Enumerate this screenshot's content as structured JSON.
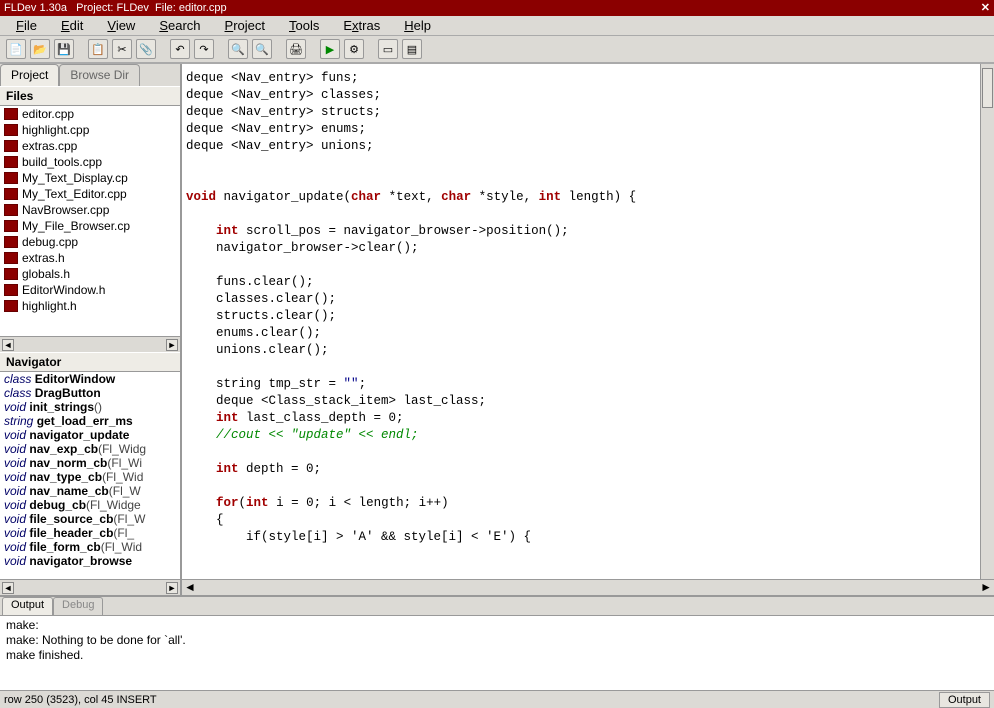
{
  "title": {
    "app": "FLDev 1.30a",
    "project_label": "Project:",
    "project": "FLDev",
    "file_label": "File:",
    "file": "editor.cpp"
  },
  "menu": {
    "file": "File",
    "edit": "Edit",
    "view": "View",
    "search": "Search",
    "project": "Project",
    "tools": "Tools",
    "extras": "Extras",
    "help": "Help"
  },
  "sidebar": {
    "tab_project": "Project",
    "tab_browse": "Browse Dir",
    "files_header": "Files",
    "files": [
      "editor.cpp",
      "highlight.cpp",
      "extras.cpp",
      "build_tools.cpp",
      "My_Text_Display.cp",
      "My_Text_Editor.cpp",
      "NavBrowser.cpp",
      "My_File_Browser.cp",
      "debug.cpp",
      "extras.h",
      "globals.h",
      "EditorWindow.h",
      "highlight.h"
    ],
    "nav_header": "Navigator",
    "nav_items": [
      {
        "type": "class",
        "name": "EditorWindow",
        "sig": ""
      },
      {
        "type": "class",
        "name": "DragButton",
        "sig": ""
      },
      {
        "type": "void",
        "name": "init_strings",
        "sig": "()"
      },
      {
        "type": "string",
        "name": "get_load_err_ms",
        "sig": ""
      },
      {
        "type": "void",
        "name": "navigator_update",
        "sig": ""
      },
      {
        "type": "void",
        "name": "nav_exp_cb",
        "sig": "(Fl_Widg"
      },
      {
        "type": "void",
        "name": "nav_norm_cb",
        "sig": "(Fl_Wi"
      },
      {
        "type": "void",
        "name": "nav_type_cb",
        "sig": "(Fl_Wid"
      },
      {
        "type": "void",
        "name": "nav_name_cb",
        "sig": "(Fl_W"
      },
      {
        "type": "void",
        "name": "debug_cb",
        "sig": "(Fl_Widge"
      },
      {
        "type": "void",
        "name": "file_source_cb",
        "sig": "(Fl_W"
      },
      {
        "type": "void",
        "name": "file_header_cb",
        "sig": "(Fl_"
      },
      {
        "type": "void",
        "name": "file_form_cb",
        "sig": "(Fl_Wid"
      },
      {
        "type": "void",
        "name": "navigator_browse",
        "sig": ""
      }
    ]
  },
  "code": {
    "l1": "deque <Nav_entry> funs;",
    "l2": "deque <Nav_entry> classes;",
    "l3": "deque <Nav_entry> structs;",
    "l4": "deque <Nav_entry> enums;",
    "l5": "deque <Nav_entry> unions;",
    "sig_void": "void",
    "sig_name": " navigator_update(",
    "sig_char": "char",
    "sig_p1": " *text, ",
    "sig_p2": " *style, ",
    "sig_int": "int",
    "sig_end": " length) {",
    "l7a": "int",
    "l7b": " scroll_pos = navigator_browser->position();",
    "l8": "navigator_browser->clear();",
    "l9": "funs.clear();",
    "l10": "classes.clear();",
    "l11": "structs.clear();",
    "l12": "enums.clear();",
    "l13": "unions.clear();",
    "l14a": "string tmp_str = ",
    "l14b": "\"\"",
    "l14c": ";",
    "l15": "deque <Class_stack_item> last_class;",
    "l16a": "int",
    "l16b": " last_class_depth = 0;",
    "l17": "//cout << \"update\" << endl;",
    "l18a": "int",
    "l18b": " depth = 0;",
    "l19a": "for",
    "l19b": "(",
    "l19c": "int",
    "l19d": " i = 0; i < length; i++)",
    "l20": "{",
    "l21": "        if(style[i] > 'A' && style[i] < 'E') {"
  },
  "output": {
    "tab_output": "Output",
    "tab_debug": "Debug",
    "lines": [
      "make:",
      "make: Nothing to be done for `all'.",
      "make finished."
    ]
  },
  "status": {
    "left": "row 250 (3523), col 45  INSERT",
    "right": "Output"
  }
}
